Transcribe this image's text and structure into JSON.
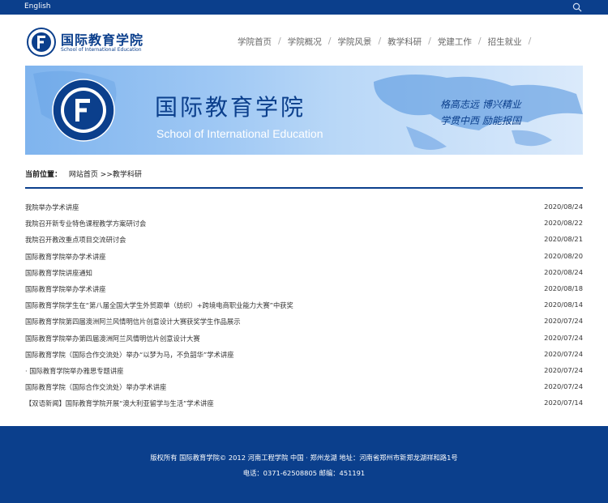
{
  "topbar": {
    "language_link": "English",
    "search_icon": "search-icon"
  },
  "header": {
    "logo_cn": "国际教育学院",
    "logo_en": "School of International Education",
    "nav": [
      "学院首页",
      "学院概况",
      "学院风景",
      "教学科研",
      "党建工作",
      "招生就业"
    ]
  },
  "banner": {
    "title_cn": "国际教育学院",
    "title_en": "School of International Education",
    "motto_line1": "格高志远  博兴精业",
    "motto_line2": "学贯中西  励能报国"
  },
  "breadcrumb": {
    "label": "当前位置：",
    "home": "网站首页",
    "current": ">>教学科研"
  },
  "news": [
    {
      "title": "我院举办学术讲座",
      "date": "2020/08/24"
    },
    {
      "title": "我院召开新专业特色课程教学方案研讨会",
      "date": "2020/08/22"
    },
    {
      "title": "我院召开教改重点项目交流研讨会",
      "date": "2020/08/21"
    },
    {
      "title": "国际教育学院举办学术讲座",
      "date": "2020/08/20"
    },
    {
      "title": "国际教育学院讲座通知",
      "date": "2020/08/24"
    },
    {
      "title": "国际教育学院举办学术讲座",
      "date": "2020/08/18"
    },
    {
      "title": "国际教育学院学生在“第八届全国大学生外贸跟单（纺织）+跨境电商职业能力大赛”中获奖",
      "date": "2020/08/14"
    },
    {
      "title": "国际教育学院第四届澳洲阿兰风情明信片创意设计大赛获奖学生作品展示",
      "date": "2020/07/24"
    },
    {
      "title": "国际教育学院举办第四届澳洲阿兰风情明信片创意设计大赛",
      "date": "2020/07/24"
    },
    {
      "title": "国际教育学院（国际合作交流处）举办“以梦为马，不负韶华”学术讲座",
      "date": "2020/07/24"
    },
    {
      "title": "· 国际教育学院举办雅思专题讲座",
      "date": "2020/07/24"
    },
    {
      "title": "国际教育学院（国际合作交流处）举办学术讲座",
      "date": "2020/07/24"
    },
    {
      "title": "【双语新闻】国际教育学院开展“澳大利亚留学与生活”学术讲座",
      "date": "2020/07/14"
    }
  ],
  "footer": {
    "copyright": "版权所有 国际教育学院© 2012 河南工程学院 中国 · 郑州龙湖 地址：河南省郑州市新郑龙湖祥和路1号",
    "contact": "电话：0371-62508805 邮编：451191"
  },
  "colors": {
    "primary": "#0b3f8c",
    "text": "#333333"
  }
}
